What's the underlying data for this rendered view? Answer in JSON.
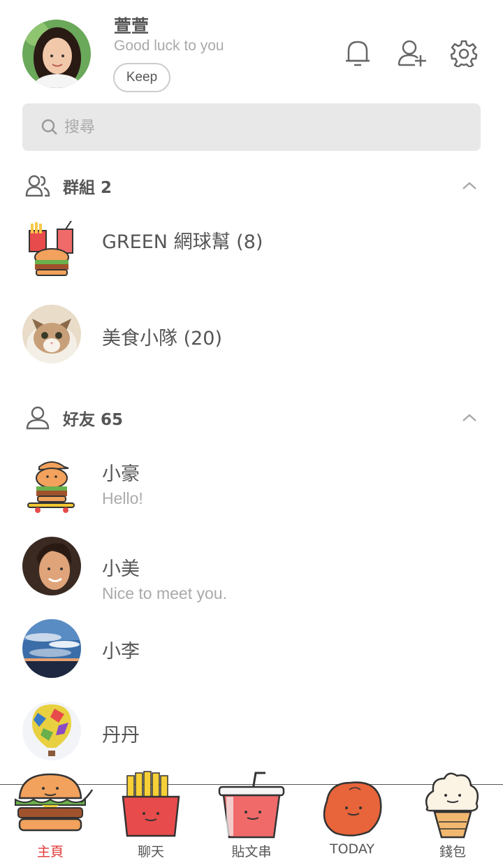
{
  "profile": {
    "name": "萱萱",
    "status": "Good luck to you",
    "keep_label": "Keep"
  },
  "header_icons": [
    "bell-icon",
    "add-friend-icon",
    "settings-gear-icon"
  ],
  "search": {
    "placeholder": "搜尋"
  },
  "groups_section": {
    "title": "群組 2",
    "items": [
      {
        "name": "GREEN 網球幫 (8)"
      },
      {
        "name": "美食小隊 (20)"
      }
    ]
  },
  "friends_section": {
    "title": "好友 65",
    "items": [
      {
        "name": "小豪",
        "message": "Hello!"
      },
      {
        "name": "小美",
        "message": "Nice to meet you."
      },
      {
        "name": "小李",
        "message": ""
      },
      {
        "name": "丹丹",
        "message": ""
      }
    ]
  },
  "bottom_nav": {
    "items": [
      {
        "label": "主頁",
        "icon": "burger-icon",
        "active": true
      },
      {
        "label": "聊天",
        "icon": "fries-icon",
        "active": false
      },
      {
        "label": "貼文串",
        "icon": "drink-cup-icon",
        "active": false
      },
      {
        "label": "TODAY",
        "icon": "nugget-icon",
        "active": false
      },
      {
        "label": "錢包",
        "icon": "ice-cream-icon",
        "active": false
      }
    ]
  },
  "colors": {
    "active_tab": "#e03a3a",
    "search_bg": "#e8e8e8"
  }
}
